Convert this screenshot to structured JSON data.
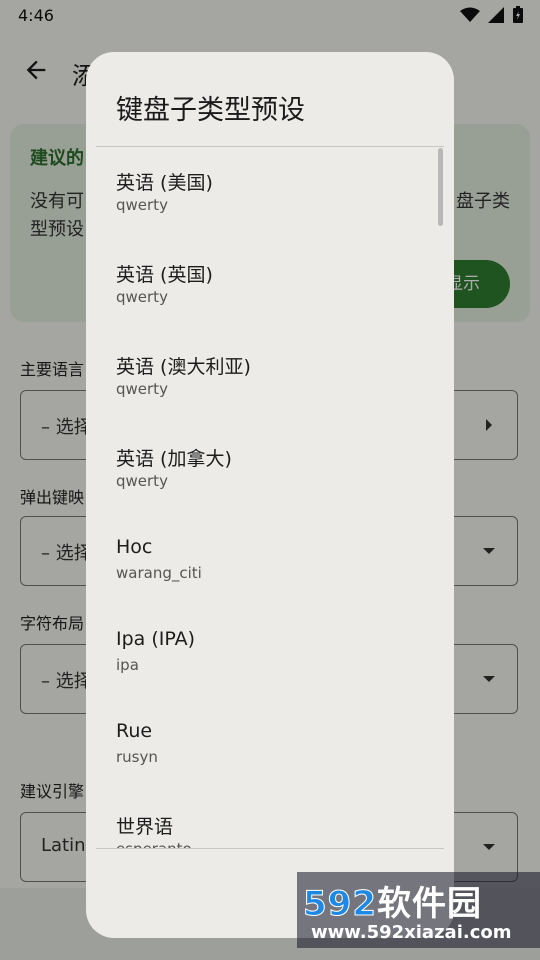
{
  "status": {
    "time": "4:46"
  },
  "background": {
    "title": "添",
    "card": {
      "title": "建议的",
      "text_left_line1": "没有可",
      "text_left_line2": "型预设",
      "text_right_line1": "盘子类",
      "button": "显示"
    },
    "fields": [
      {
        "label": "主要语言",
        "value": "– 选择"
      },
      {
        "label": "弹出键映",
        "value": "– 选择"
      },
      {
        "label": "字符布局",
        "value": "– 选择"
      },
      {
        "label": "建议引擎",
        "value": "Latin"
      }
    ]
  },
  "dialog": {
    "title": "键盘子类型预设",
    "items": [
      {
        "primary": "英语 (美国)",
        "secondary": "qwerty"
      },
      {
        "primary": "英语 (英国)",
        "secondary": "qwerty"
      },
      {
        "primary": "英语 (澳大利亚)",
        "secondary": "qwerty"
      },
      {
        "primary": "英语 (加拿大)",
        "secondary": "qwerty"
      },
      {
        "primary": "Hoc",
        "secondary": "warang_citi"
      },
      {
        "primary": "Ipa (IPA)",
        "secondary": "ipa"
      },
      {
        "primary": "Rue",
        "secondary": "rusyn"
      },
      {
        "primary": "世界语",
        "secondary": "esperanto"
      }
    ]
  },
  "watermark": {
    "brand_num": "592",
    "brand_text": "软件园",
    "url": "www.592xiazai.com"
  }
}
